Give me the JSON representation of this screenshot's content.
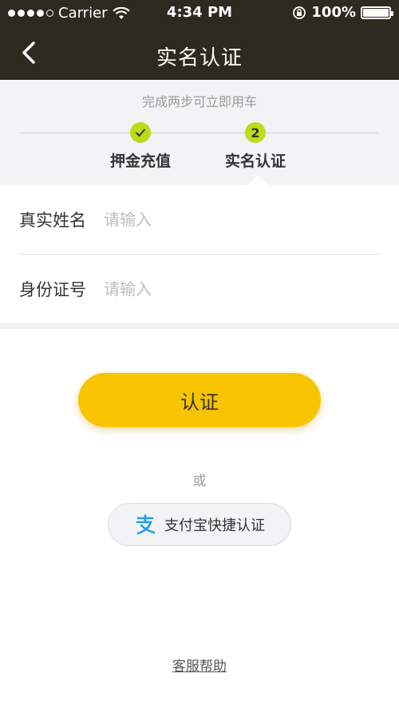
{
  "status_bar": {
    "carrier": "Carrier",
    "time": "4:34 PM",
    "battery": "100%"
  },
  "nav": {
    "title": "实名认证",
    "back_icon": "chevron-left-icon"
  },
  "steps": {
    "hint": "完成两步可立即用车",
    "items": [
      {
        "label": "押金充值",
        "marker": "check-icon",
        "state": "done"
      },
      {
        "label": "实名认证",
        "marker": "2",
        "state": "current"
      }
    ],
    "accent": "#b8dd1a"
  },
  "form": {
    "name_label": "真实姓名",
    "name_placeholder": "请输入",
    "id_label": "身份证号",
    "id_placeholder": "请输入"
  },
  "actions": {
    "verify_label": "认证",
    "verify_color": "#f8c400",
    "or_text": "或",
    "alipay_label": "支付宝快捷认证",
    "alipay_icon": "alipay-icon",
    "help_label": "客服帮助"
  }
}
